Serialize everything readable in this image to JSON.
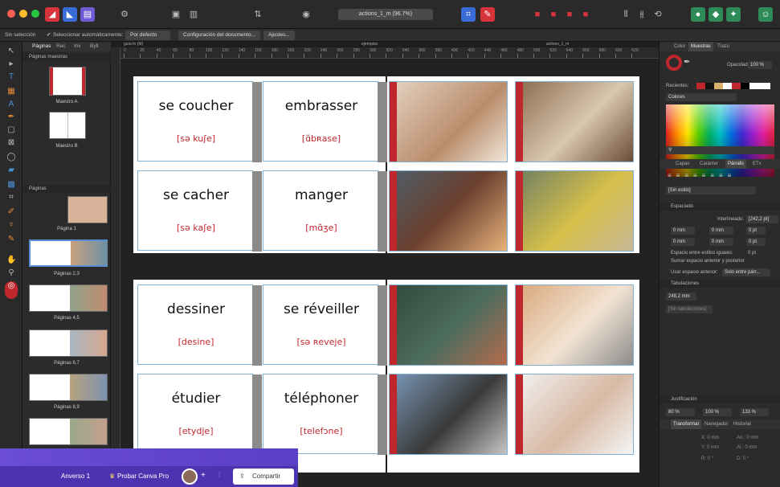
{
  "window": {
    "doc_title": "actions_1_m (96.7%)"
  },
  "context_bar": {
    "no_selection": "Sin selección",
    "auto_select": "Seleccionar automáticamente:",
    "default": "Por defecto",
    "doc_settings": "Configuración del documento...",
    "adjustments": "Ajustes..."
  },
  "pages_panel": {
    "tabs": [
      "Páginas",
      "Rec",
      "Inv",
      "Byll"
    ],
    "masters_header": "Páginas maestras",
    "master_a": "Maestro A",
    "master_b": "Maestro B",
    "pages_header": "Páginas",
    "labels": [
      "Página 1",
      "Páginas 2,3",
      "Páginas 4,5",
      "Páginas 6,7",
      "Páginas 8,9"
    ]
  },
  "ruler": {
    "labels": [
      "0",
      "20",
      "40",
      "60",
      "80",
      "100",
      "120",
      "140",
      "160",
      "180",
      "200",
      "220",
      "240",
      "260",
      "280",
      "300",
      "320",
      "340",
      "360",
      "380",
      "400",
      "420",
      "440",
      "460",
      "480",
      "500",
      "520",
      "540",
      "560",
      "580",
      "600",
      "620"
    ],
    "top_left": "guía fn (M)",
    "top_mid": "ejemplos",
    "top_right": "actions_1_m"
  },
  "cards": [
    {
      "word": "se coucher",
      "ipa": "[sə kuʃe]"
    },
    {
      "word": "embrasser",
      "ipa": "[ɑ̃bʀase]"
    },
    {
      "word": "se cacher",
      "ipa": "[sə kaʃe]"
    },
    {
      "word": "manger",
      "ipa": "[mɑ̃ʒe]"
    },
    {
      "word": "dessiner",
      "ipa": "[desine]"
    },
    {
      "word": "se réveiller",
      "ipa": "[sə ʀeveje]"
    },
    {
      "word": "étudier",
      "ipa": "[etydje]"
    },
    {
      "word": "téléphoner",
      "ipa": "[telefɔne]"
    }
  ],
  "right_panel": {
    "tabs1": [
      "Color",
      "Muestras",
      "Trazo"
    ],
    "opacity_label": "Opacidad:",
    "opacity": "100 %",
    "recent": "Recientes:",
    "palette": "Colores",
    "tabs2": [
      "Capas",
      "Carácter",
      "Párrafo",
      "ETx"
    ],
    "style": "[Sin estilo]",
    "spacing": "Espaciado",
    "leading_label": "Interlineado:",
    "leading": "[242,2 pt]",
    "mm0a": "0 mm",
    "mm0b": "0 mm",
    "mm0c": "0 mm",
    "mm0d": "0 mm",
    "pt0a": "0 pt",
    "pt0b": "0 pt",
    "same_styles": "Espacio entre estilos iguales:",
    "same_val": "0 pt",
    "add_space": "Sumar espacio anterior y posterior",
    "use_space": "Usar espacio anterior:",
    "use_val": "Solo entre párr...",
    "tabs_header": "Tabulaciones",
    "tab_val": "248,2 mm",
    "no_tabs": "[Sin tabulaciones]",
    "justif": "Justificación",
    "j1": "80 %",
    "j2": "100 %",
    "j3": "133 %",
    "tabs3": [
      "Transformar",
      "Navegador",
      "Historial"
    ],
    "x": "X: 0 mm",
    "y": "Y: 0 mm",
    "an": "An.: 0 mm",
    "al": "Al.: 0 mm",
    "r": "R: 0 °",
    "d": "D: 0 °"
  },
  "canva": {
    "page": "Anverso 1",
    "pro": "Probar Canva Pro",
    "share": "Compartir"
  },
  "colors": {
    "accent": "#c0272d",
    "card_border": "#7fb1d6"
  }
}
